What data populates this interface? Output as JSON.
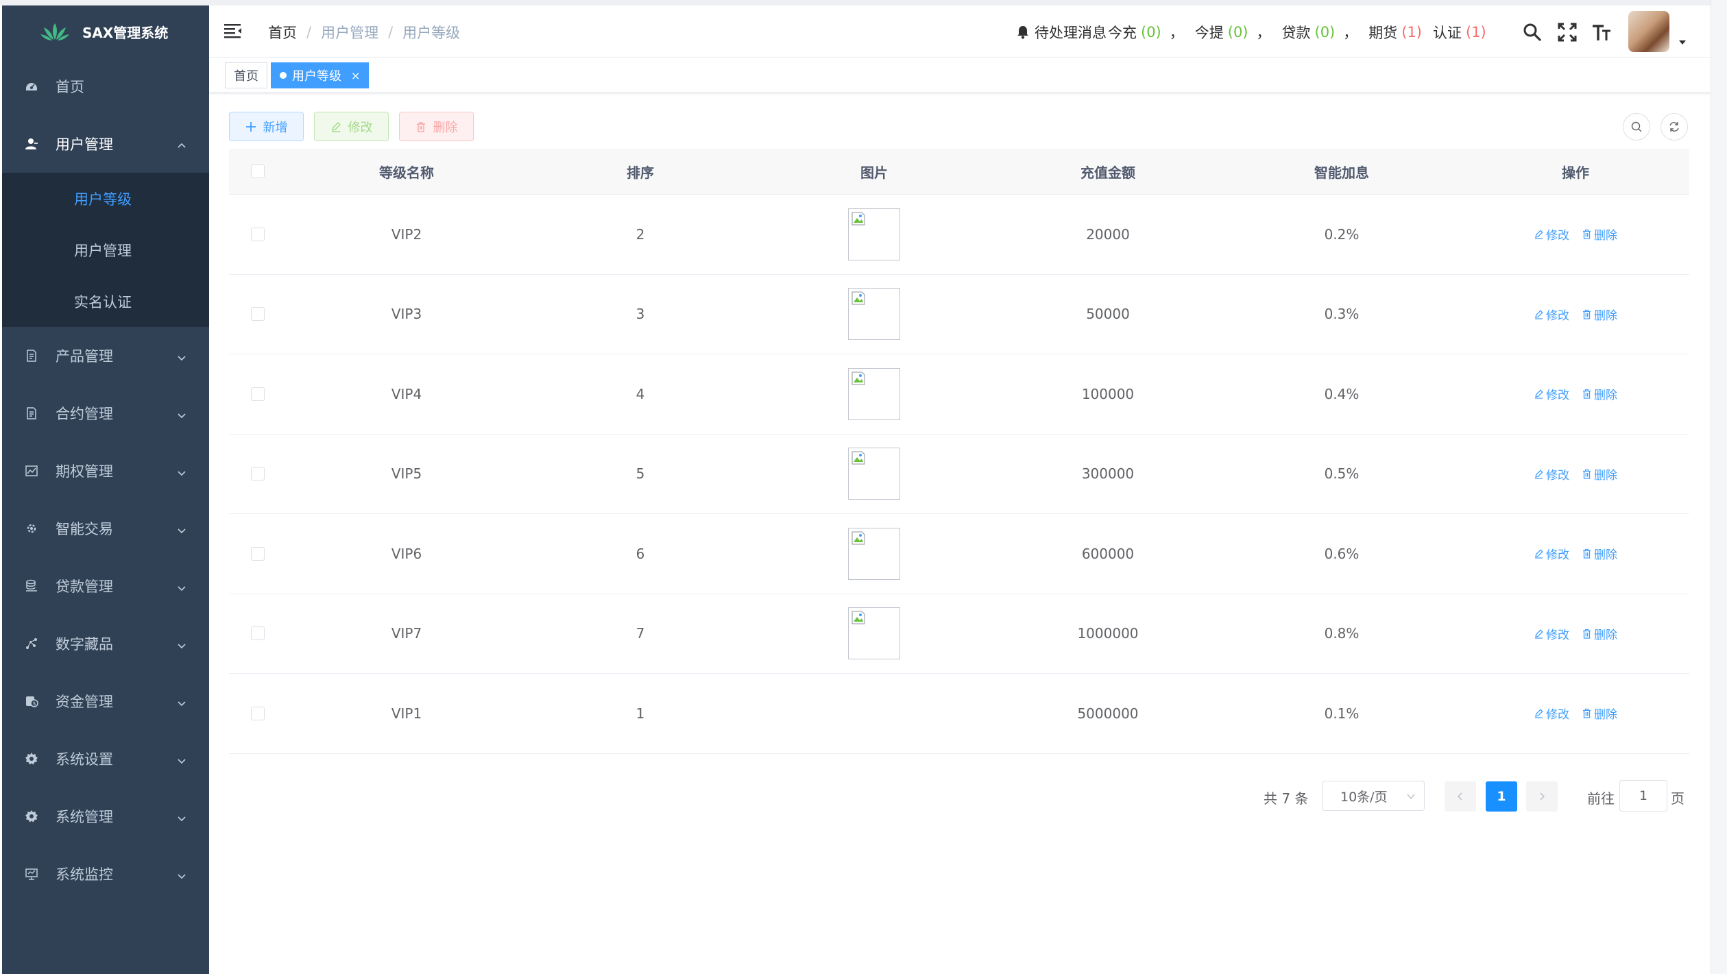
{
  "app": {
    "title": "SAX管理系统"
  },
  "sidebar": {
    "items": [
      {
        "label": "首页",
        "icon": "dashboard-icon"
      },
      {
        "label": "用户管理",
        "icon": "user-icon",
        "open": true,
        "children": [
          {
            "label": "用户等级",
            "active": true
          },
          {
            "label": "用户管理"
          },
          {
            "label": "实名认证"
          }
        ]
      },
      {
        "label": "产品管理",
        "icon": "document-icon"
      },
      {
        "label": "合约管理",
        "icon": "document-icon"
      },
      {
        "label": "期权管理",
        "icon": "chart-icon"
      },
      {
        "label": "智能交易",
        "icon": "gear-small-icon"
      },
      {
        "label": "贷款管理",
        "icon": "stack-icon"
      },
      {
        "label": "数字藏品",
        "icon": "nodes-icon"
      },
      {
        "label": "资金管理",
        "icon": "money-icon"
      },
      {
        "label": "系统设置",
        "icon": "settings-icon"
      },
      {
        "label": "系统管理",
        "icon": "settings-icon"
      },
      {
        "label": "系统监控",
        "icon": "monitor-icon"
      }
    ]
  },
  "breadcrumb": [
    "首页",
    "用户管理",
    "用户等级"
  ],
  "notice": {
    "prefix": "待处理消息",
    "items": [
      {
        "label": "今充",
        "count": "(0)",
        "color": "green"
      },
      {
        "label": "今提",
        "count": "(0)",
        "color": "green"
      },
      {
        "label": "贷款",
        "count": "(0)",
        "color": "green"
      },
      {
        "label": "期货",
        "count": "(1)",
        "color": "red"
      },
      {
        "label": "认证",
        "count": "(1)",
        "color": "red"
      }
    ],
    "separator": "，"
  },
  "tags": [
    {
      "label": "首页",
      "active": false
    },
    {
      "label": "用户等级",
      "active": true,
      "close": "×"
    }
  ],
  "toolbar": {
    "add_label": "新增",
    "edit_label": "修改",
    "delete_label": "删除"
  },
  "table": {
    "columns": [
      "等级名称",
      "排序",
      "图片",
      "充值金额",
      "智能加息",
      "操作"
    ],
    "rows": [
      {
        "name": "VIP2",
        "sort": "2",
        "has_image": true,
        "amount": "20000",
        "rate": "0.2%"
      },
      {
        "name": "VIP3",
        "sort": "3",
        "has_image": true,
        "amount": "50000",
        "rate": "0.3%"
      },
      {
        "name": "VIP4",
        "sort": "4",
        "has_image": true,
        "amount": "100000",
        "rate": "0.4%"
      },
      {
        "name": "VIP5",
        "sort": "5",
        "has_image": true,
        "amount": "300000",
        "rate": "0.5%"
      },
      {
        "name": "VIP6",
        "sort": "6",
        "has_image": true,
        "amount": "600000",
        "rate": "0.6%"
      },
      {
        "name": "VIP7",
        "sort": "7",
        "has_image": true,
        "amount": "1000000",
        "rate": "0.8%"
      },
      {
        "name": "VIP1",
        "sort": "1",
        "has_image": false,
        "amount": "5000000",
        "rate": "0.1%"
      }
    ],
    "row_edit_label": "修改",
    "row_delete_label": "删除"
  },
  "pagination": {
    "total_text": "共 7 条",
    "page_size": "10条/页",
    "current_page": "1",
    "goto_label": "前往",
    "goto_value": "1",
    "page_unit": "页"
  },
  "colors": {
    "sidebar_bg": "#304156",
    "submenu_bg": "#1f2d3d",
    "accent": "#409eff",
    "success": "#67c23a",
    "danger": "#f56c6c"
  }
}
